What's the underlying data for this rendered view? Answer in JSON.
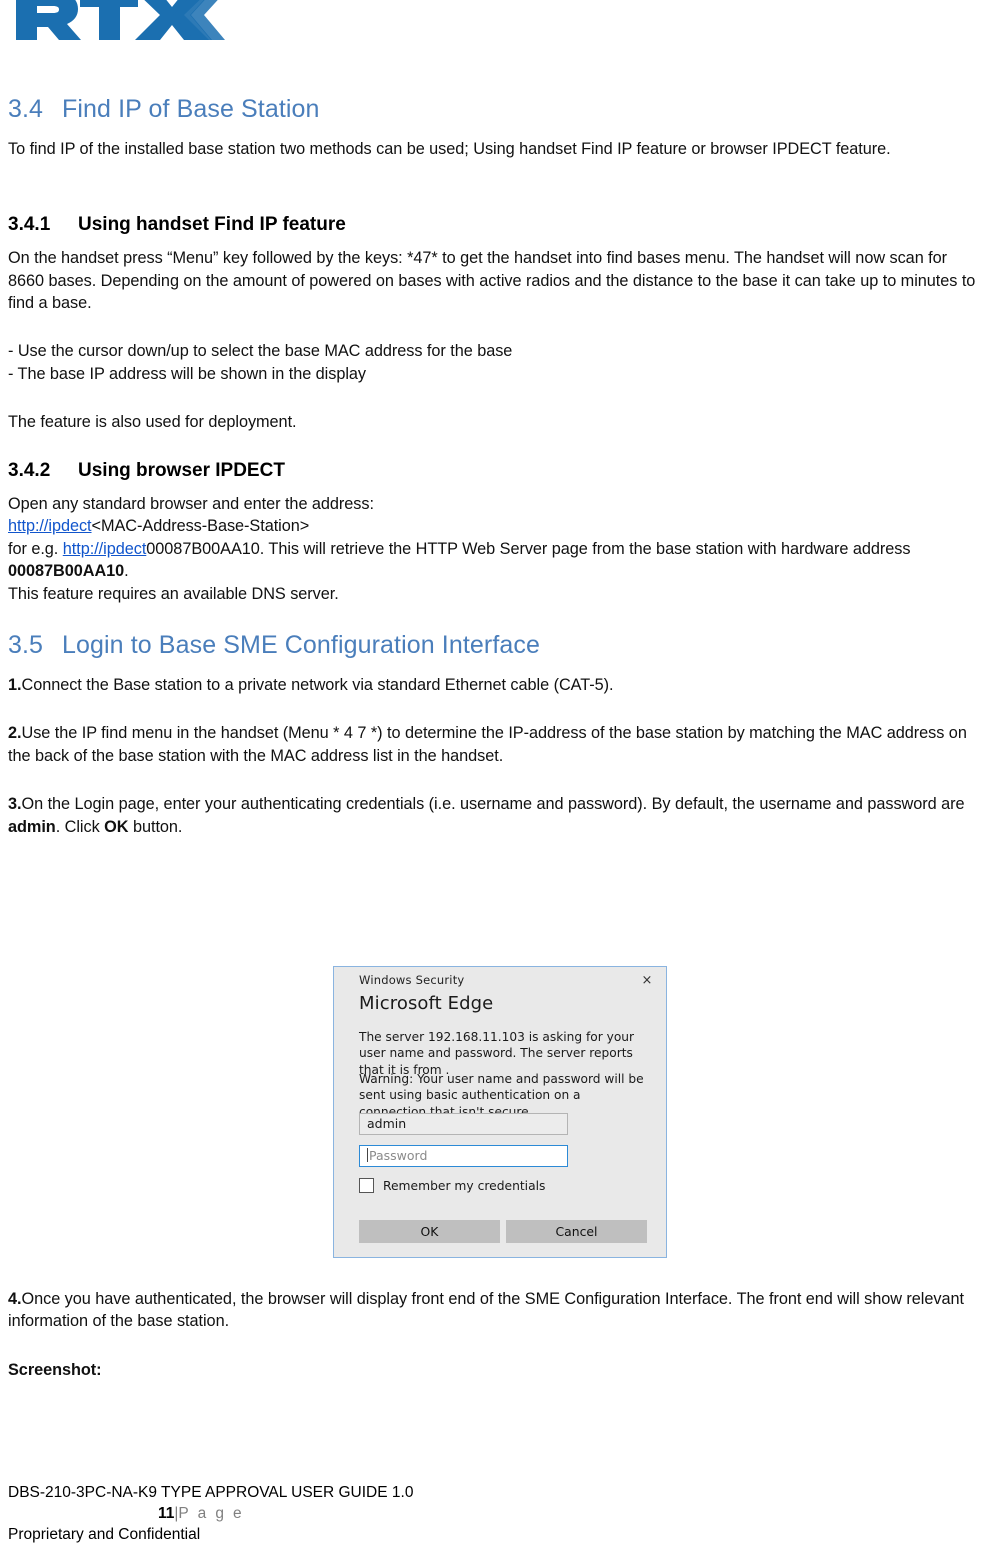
{
  "header": {
    "logo_alt": "RTX",
    "logo_color": "#1B6FB0"
  },
  "sections": {
    "s34": {
      "number": "3.4",
      "title": "Find IP of Base Station",
      "intro": "To find IP of the installed base station two methods can be used; Using handset Find IP feature or browser IPDECT feature."
    },
    "s341": {
      "number": "3.4.1",
      "title": "Using handset Find IP feature",
      "p1": "On the handset press “Menu” key followed by the keys: *47* to get the handset into find bases menu. The handset will now scan for 8660 bases. Depending on the amount of powered on bases with active radios and the distance to the base it can take up to minutes to find a base.",
      "bullet1": "- Use the cursor down/up to select the base MAC address for the base",
      "bullet2": "- The base IP address will be shown in the display",
      "p2": "The feature is also used for deployment."
    },
    "s342": {
      "number": "3.4.2",
      "title": "Using browser IPDECT",
      "line1": "Open any standard browser and enter the address:",
      "line2_link": "http://ipdect",
      "line2_rest": "<MAC-Address-Base-Station>",
      "line3_prefix": "for e.g. ",
      "line3_link": "http://ipdect",
      "line3_mid": "00087B00AA10. This will retrieve the HTTP Web Server page from the base station with hardware address ",
      "line3_bold": "00087B00AA10",
      "line3_end": ".",
      "line4": "This feature requires an available DNS server."
    },
    "s35": {
      "number": "3.5",
      "title": "Login to Base SME Configuration Interface",
      "step1_num": "1.",
      "step1": "Connect the Base station to a private network via standard Ethernet cable (CAT-5).",
      "step2_num": "2.",
      "step2": "Use the IP find menu in the handset (Menu * 4 7 *) to determine the IP-address of the base station by matching the MAC address on the back of the base station with the MAC address list in the handset.",
      "step3_num": "3.",
      "step3_a": "On the Login page, enter your authenticating credentials (i.e. username and password). By default, the username and password are ",
      "step3_bold1": "admin",
      "step3_b": ". Click ",
      "step3_bold2": "OK",
      "step3_c": " button.",
      "step4_num": "4.",
      "step4": "Once you have authenticated, the browser will display front end of the SME Configuration Interface. The front end will show relevant information of the base station.",
      "screenshot_label": "Screenshot:"
    }
  },
  "dialog": {
    "title": "Windows Security",
    "app_name": "Microsoft Edge",
    "message": "The server 192.168.11.103 is asking for your user name and password. The server reports that it is from .",
    "warning": "Warning: Your user name and password will be sent using basic authentication on a connection that isn't secure.",
    "username_value": "admin",
    "password_placeholder": "Password",
    "remember_label": "Remember my credentials",
    "ok_label": "OK",
    "cancel_label": "Cancel",
    "close_icon": "×",
    "focus_color": "#2c8ad6",
    "border_color": "#8ab4e0"
  },
  "footer": {
    "doc_title": "DBS-210-3PC-NA-K9 TYPE APPROVAL USER GUIDE 1.0",
    "page_number": "11",
    "page_separator": "|",
    "page_word": "P a g e",
    "confidential": "Proprietary and Confidential"
  }
}
